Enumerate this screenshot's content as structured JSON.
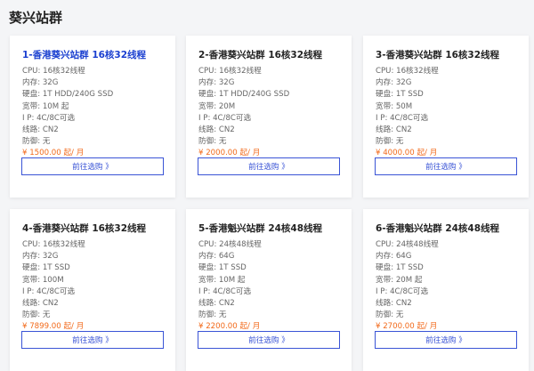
{
  "page": {
    "title": "葵兴站群"
  },
  "cards": [
    {
      "title": "1-香港葵兴站群 16核32线程",
      "specs": [
        {
          "k": "CPU:",
          "v": "16核32线程"
        },
        {
          "k": "内存:",
          "v": "32G"
        },
        {
          "k": "硬盘:",
          "v": "1T HDD/240G SSD"
        },
        {
          "k": "宽带:",
          "v": "10M 起"
        },
        {
          "k": "I P:",
          "v": "4C/8C可选"
        },
        {
          "k": "线路:",
          "v": "CN2"
        },
        {
          "k": "防御:",
          "v": "无"
        }
      ],
      "price": "¥ 1500.00 起/ 月",
      "button": "前往选购 》"
    },
    {
      "title": "2-香港葵兴站群 16核32线程",
      "specs": [
        {
          "k": "CPU:",
          "v": "16核32线程"
        },
        {
          "k": "内存:",
          "v": "32G"
        },
        {
          "k": "硬盘:",
          "v": "1T HDD/240G SSD"
        },
        {
          "k": "宽带:",
          "v": "20M"
        },
        {
          "k": "I P:",
          "v": "4C/8C可选"
        },
        {
          "k": "线路:",
          "v": "CN2"
        },
        {
          "k": "防御:",
          "v": "无"
        }
      ],
      "price": "¥ 2000.00 起/ 月",
      "button": "前往选购 》"
    },
    {
      "title": "3-香港葵兴站群 16核32线程",
      "specs": [
        {
          "k": "CPU:",
          "v": "16核32线程"
        },
        {
          "k": "内存:",
          "v": "32G"
        },
        {
          "k": "硬盘:",
          "v": "1T SSD"
        },
        {
          "k": "宽带:",
          "v": "50M"
        },
        {
          "k": "I P:",
          "v": "4C/8C可选"
        },
        {
          "k": "线路:",
          "v": "CN2"
        },
        {
          "k": "防御:",
          "v": "无"
        }
      ],
      "price": "¥ 4000.00 起/ 月",
      "button": "前往选购 》"
    },
    {
      "title": "4-香港葵兴站群 16核32线程",
      "specs": [
        {
          "k": "CPU:",
          "v": "16核32线程"
        },
        {
          "k": "内存:",
          "v": "32G"
        },
        {
          "k": "硬盘:",
          "v": "1T SSD"
        },
        {
          "k": "宽带:",
          "v": "100M"
        },
        {
          "k": "I P:",
          "v": "4C/8C可选"
        },
        {
          "k": "线路:",
          "v": "CN2"
        },
        {
          "k": "防御:",
          "v": "无"
        }
      ],
      "price": "¥ 7899.00 起/ 月",
      "button": "前往选购 》"
    },
    {
      "title": "5-香港魁兴站群 24核48线程",
      "specs": [
        {
          "k": "CPU:",
          "v": "24核48线程"
        },
        {
          "k": "内存:",
          "v": "64G"
        },
        {
          "k": "硬盘:",
          "v": "1T SSD"
        },
        {
          "k": "宽带:",
          "v": "10M 起"
        },
        {
          "k": "I P:",
          "v": "4C/8C可选"
        },
        {
          "k": "线路:",
          "v": "CN2"
        },
        {
          "k": "防御:",
          "v": "无"
        }
      ],
      "price": "¥ 2200.00 起/ 月",
      "button": "前往选购 》"
    },
    {
      "title": "6-香港魁兴站群 24核48线程",
      "specs": [
        {
          "k": "CPU:",
          "v": "24核48线程"
        },
        {
          "k": "内存:",
          "v": "64G"
        },
        {
          "k": "硬盘:",
          "v": "1T SSD"
        },
        {
          "k": "宽带:",
          "v": "20M 起"
        },
        {
          "k": "I P:",
          "v": "4C/8C可选"
        },
        {
          "k": "线路:",
          "v": "CN2"
        },
        {
          "k": "防御:",
          "v": "无"
        }
      ],
      "price": "¥ 2700.00 起/ 月",
      "button": "前往选购 》"
    }
  ],
  "colors": {
    "title_active": "#1a3fd0",
    "price": "#f26a1b",
    "button": "#3a54d6"
  }
}
